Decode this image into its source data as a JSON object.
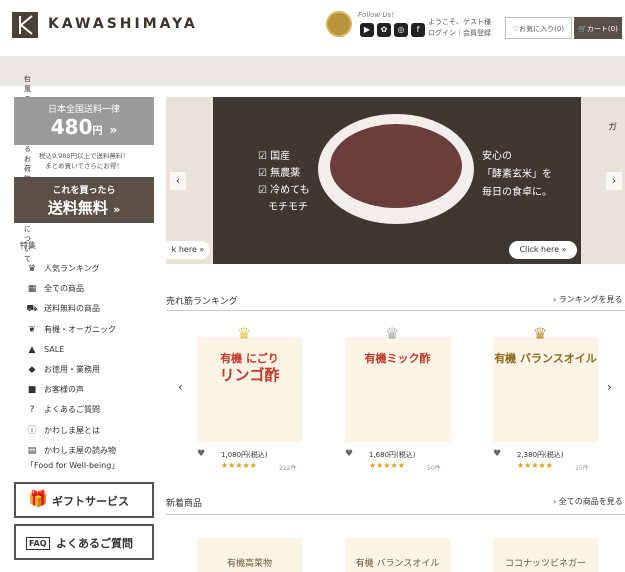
{
  "header": {
    "logo_text": "KAWASHIMAYA",
    "follow_text": "Follow Us!",
    "social": [
      "▶",
      "✿",
      "◎",
      "f"
    ],
    "welcome_line1": "ようこそ、ゲスト様",
    "welcome_line2": "ログイン｜会員登録",
    "favorites_label": "お気に入り(0)",
    "cart_label": "カート(0)"
  },
  "notice": "台風の影響によるお荷物のお届けについて",
  "sidebar": {
    "shipping_line1": "日本全国送料一律",
    "shipping_price": "480",
    "shipping_unit": "円",
    "shipping_note": "税込9,980円以上で送料無料！\nまとめ買いでさらにお得！",
    "free_line1": "これを買ったら",
    "free_line2": "送料無料",
    "section_title": "特集",
    "items": [
      {
        "icon": "♛",
        "label": "人気ランキング"
      },
      {
        "icon": "▦",
        "label": "全ての商品"
      },
      {
        "icon": "⛟",
        "label": "送料無料の商品"
      },
      {
        "icon": "❦",
        "label": "有機・オーガニック"
      },
      {
        "icon": "▲",
        "label": "SALE"
      },
      {
        "icon": "◆",
        "label": "お徳用・業務用"
      },
      {
        "icon": "■",
        "label": "お客様の声"
      },
      {
        "icon": "?",
        "label": "よくあるご質問"
      },
      {
        "icon": "ⓘ",
        "label": "かわしま屋とは"
      },
      {
        "icon": "▤",
        "label": "かわしま屋の読み物"
      }
    ],
    "food_label": "「Food for Well-being」",
    "gift_label": "ギフトサービス",
    "faq_label": "よくあるご質問"
  },
  "banner": {
    "left_text": [
      "☑ 国産",
      "☑ 無農薬",
      "☑ 冷めても",
      "　モチモチ"
    ],
    "right_text": [
      "安心の",
      "「酵素玄米」を",
      "毎日の食卓に。"
    ],
    "click_here": "Click here »",
    "click_here_left": "k here »",
    "side_text": "ガ"
  },
  "ranking": {
    "title": "売れ筋ランキング",
    "link": "ランキングを見る",
    "products": [
      {
        "name_line1": "有機 にごり",
        "name_line2": "リンゴ酢",
        "price": "1,080円(税込)",
        "stars": "★★★★★",
        "reviews": "212件",
        "color": "#c0392b",
        "rank_color": "#e8c35a"
      },
      {
        "name_line1": "有機ミック酢",
        "name_line2": "",
        "price": "1,680円(税込)",
        "stars": "★★★★★",
        "reviews": "50件",
        "color": "#c0392b",
        "rank_color": "#b0b0b0"
      },
      {
        "name_line1": "有機 バランスオイル",
        "name_line2": "",
        "price": "2,380円(税込)",
        "stars": "★★★★★",
        "reviews": "15件",
        "color": "#8a6d1e",
        "rank_color": "#c8913a"
      }
    ]
  },
  "new_items": {
    "title": "新着商品",
    "link": "全ての商品を見る",
    "products": [
      {
        "label": "有機高菜物"
      },
      {
        "label": "有機 バランスオイル"
      },
      {
        "label": "ココナッツビネガー"
      }
    ]
  },
  "colors": {
    "brand_dark": "#5c5046",
    "accent_gold": "#e0a020",
    "notice_bg": "#ebe8e4"
  }
}
